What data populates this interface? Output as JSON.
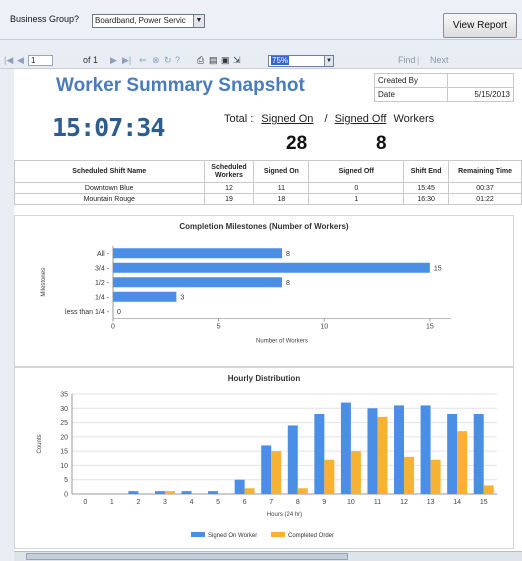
{
  "params": {
    "label": "Business Group?",
    "value": "Boardband, Power Servic",
    "view_button": "View Report"
  },
  "toolbar": {
    "page": "1",
    "of": "of 1",
    "zoom": "75%",
    "find": "Find",
    "next": "Next"
  },
  "report": {
    "title": "Worker Summary Snapshot",
    "created_by_label": "Created By",
    "created_by_value": "",
    "date_label": "Date",
    "date_value": "5/15/2013",
    "clock": "15:07:34",
    "total_label": "Total :",
    "signed_on_label": "Signed On",
    "slash": "/",
    "signed_off_label": "Signed Off",
    "workers_label": "Workers",
    "signed_on_total": "28",
    "signed_off_total": "8"
  },
  "shift_table": {
    "headers": [
      "Scheduled Shift Name",
      "Scheduled Workers",
      "Signed On",
      "Signed Off",
      "Shift End",
      "Remaining Time"
    ],
    "rows": [
      [
        "Downtown Blue",
        "12",
        "11",
        "0",
        "15:45",
        "00:37"
      ],
      [
        "Mountain Rouge",
        "19",
        "18",
        "1",
        "16:30",
        "01:22"
      ]
    ]
  },
  "chart_data": [
    {
      "type": "bar",
      "orientation": "horizontal",
      "title": "Completion Milestones (Number of Workers)",
      "xlabel": "Number of Workers",
      "ylabel": "Milestones",
      "categories": [
        "All",
        "3/4",
        "1/2",
        "1/4",
        "less than 1/4"
      ],
      "values": [
        8,
        15,
        8,
        3,
        0
      ],
      "xlim": [
        0,
        16
      ],
      "xticks": [
        0,
        5,
        10,
        15
      ],
      "color": "#4a8ee6"
    },
    {
      "type": "bar",
      "title": "Hourly Distribution",
      "xlabel": "Hours (24 hr)",
      "ylabel": "Counts",
      "categories": [
        "0",
        "1",
        "2",
        "3",
        "4",
        "5",
        "6",
        "7",
        "8",
        "9",
        "10",
        "11",
        "12",
        "13",
        "14",
        "15"
      ],
      "series": [
        {
          "name": "Signed On Worker",
          "color": "#4a8ee6",
          "values": [
            0,
            0,
            1,
            1,
            1,
            1,
            5,
            17,
            24,
            28,
            32,
            30,
            31,
            31,
            28,
            28
          ]
        },
        {
          "name": "Completed Order",
          "color": "#f7b234",
          "values": [
            0,
            0,
            0,
            1,
            0,
            0,
            2,
            15,
            2,
            12,
            15,
            27,
            13,
            12,
            22,
            3
          ]
        }
      ],
      "ylim": [
        0,
        35
      ],
      "yticks": [
        0,
        5,
        10,
        15,
        20,
        25,
        30,
        35
      ]
    }
  ]
}
